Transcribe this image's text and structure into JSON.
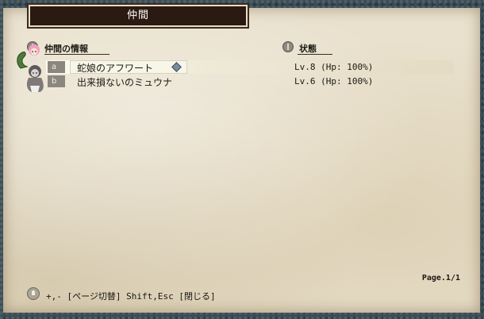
{
  "title": "仲間",
  "sections": {
    "party_info": "仲間の情報",
    "status": "状態"
  },
  "members": [
    {
      "slot": "a",
      "name": "蛇娘のアフワート",
      "status": "Lv.8 (Hp: 100%)",
      "selected": true
    },
    {
      "slot": "b",
      "name": "出来損ないのミュウナ",
      "status": "Lv.6 (Hp: 100%)",
      "selected": false
    }
  ],
  "page_indicator": "Page.1/1",
  "help_text": "+,- [ページ切替]  Shift,Esc [閉じる]",
  "icons": {
    "section": "info-icon",
    "selected_marker": "gem-icon",
    "help": "lightbulb-icon"
  }
}
